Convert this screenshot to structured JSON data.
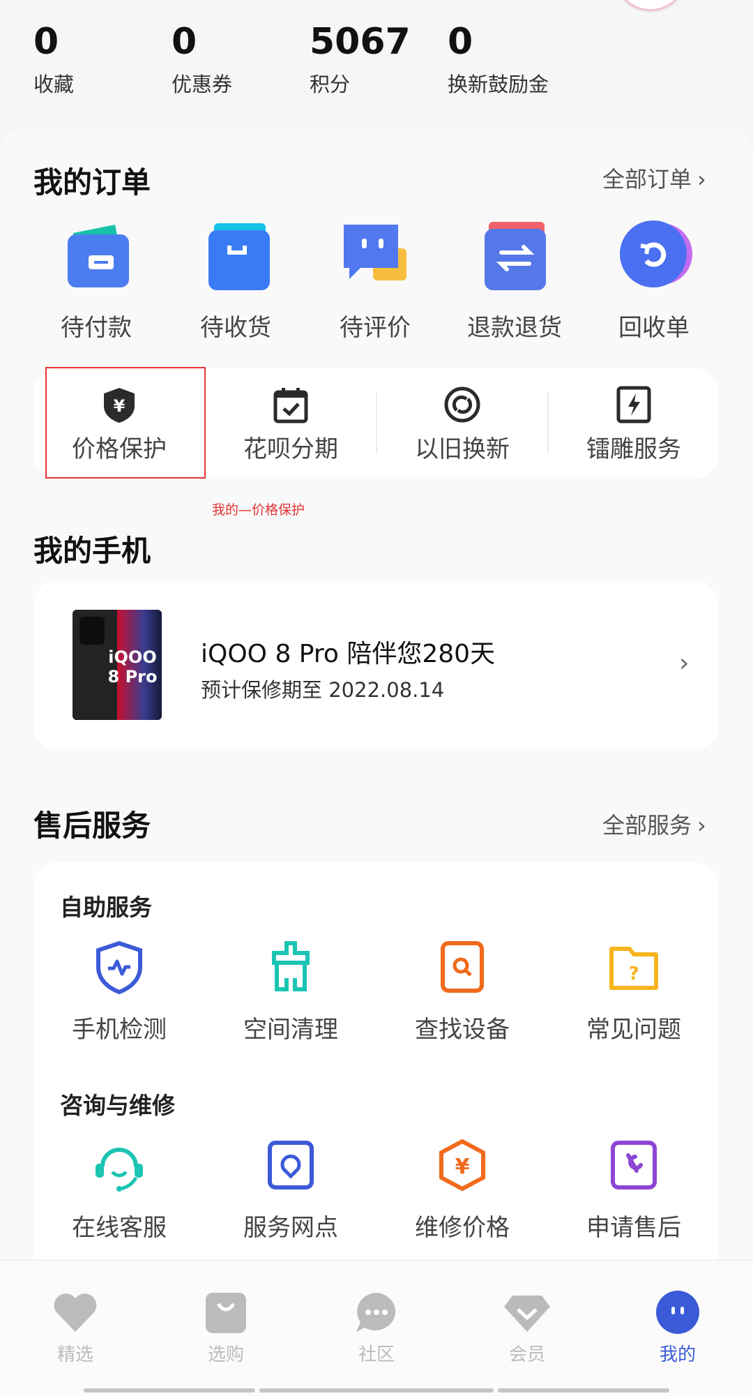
{
  "stats": [
    {
      "value": "0",
      "label": "收藏"
    },
    {
      "value": "0",
      "label": "优惠券"
    },
    {
      "value": "5067",
      "label": "积分"
    },
    {
      "value": "0",
      "label": "换新鼓励金"
    }
  ],
  "orders": {
    "title": "我的订单",
    "all_link": "全部订单",
    "items": [
      {
        "label": "待付款",
        "icon": "wallet-icon"
      },
      {
        "label": "待收货",
        "icon": "shopping-bag-icon"
      },
      {
        "label": "待评价",
        "icon": "chat-bubble-icon"
      },
      {
        "label": "退款退货",
        "icon": "exchange-icon"
      },
      {
        "label": "回收单",
        "icon": "recycle-icon"
      }
    ]
  },
  "services": [
    {
      "label": "价格保护",
      "icon": "price-shield-icon"
    },
    {
      "label": "花呗分期",
      "icon": "calendar-check-icon"
    },
    {
      "label": "以旧换新",
      "icon": "trade-in-icon"
    },
    {
      "label": "镭雕服务",
      "icon": "laser-engrave-icon"
    }
  ],
  "annotation": "我的—价格保护",
  "my_phone": {
    "title": "我的手机",
    "name": "iQOO 8 Pro 陪伴您280天",
    "warranty": "预计保修期至 2022.08.14",
    "image_text": "iQOO 8 Pro"
  },
  "after_sales": {
    "title": "售后服务",
    "all_link": "全部服务",
    "self_service": {
      "title": "自助服务",
      "items": [
        {
          "label": "手机检测",
          "icon": "phone-check-icon"
        },
        {
          "label": "空间清理",
          "icon": "cleanup-icon"
        },
        {
          "label": "查找设备",
          "icon": "find-device-icon"
        },
        {
          "label": "常见问题",
          "icon": "faq-folder-icon"
        }
      ]
    },
    "repair": {
      "title": "咨询与维修",
      "items": [
        {
          "label": "在线客服",
          "icon": "headset-icon"
        },
        {
          "label": "服务网点",
          "icon": "service-point-icon"
        },
        {
          "label": "维修价格",
          "icon": "repair-price-icon"
        },
        {
          "label": "申请售后",
          "icon": "wrench-icon"
        }
      ]
    }
  },
  "tabs": [
    {
      "label": "精选",
      "icon": "heart-icon"
    },
    {
      "label": "选购",
      "icon": "bag-icon"
    },
    {
      "label": "社区",
      "icon": "community-icon"
    },
    {
      "label": "会员",
      "icon": "diamond-icon"
    },
    {
      "label": "我的",
      "icon": "me-icon",
      "active": true
    }
  ],
  "colors": {
    "accent": "#3b5ad7",
    "highlight": "#e53333"
  }
}
